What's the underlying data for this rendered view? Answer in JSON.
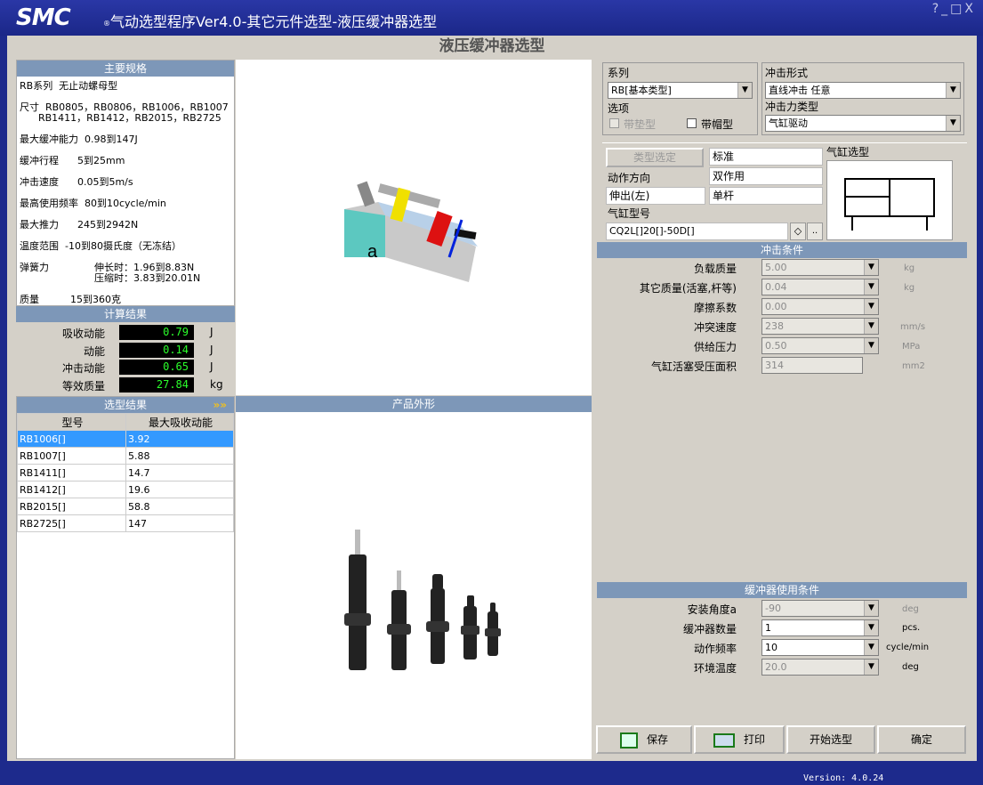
{
  "window": {
    "logo": "SMC",
    "logo_mark": "®",
    "title": "气动选型程序Ver4.0-其它元件选型-液压缓冲器选型",
    "controls": "?_□X"
  },
  "page_title": "液压缓冲器选型",
  "specs": {
    "header": "主要规格",
    "series": "RB系列  无止动螺母型",
    "sizes_1": "尺寸  RB0805，RB0806，RB1006，RB1007",
    "sizes_2": "      RB1411，RB1412，RB2015，RB2725",
    "energy": "最大缓冲能力  0.98到147J",
    "stroke": "缓冲行程      5到25mm",
    "speed": "冲击速度      0.05到5m/s",
    "freq": "最高使用频率  80到10cycle/min",
    "thrust": "最大推力      245到2942N",
    "temp": "温度范围  -10到80摄氏度（无冻结）",
    "spring_label": "弹簧力",
    "spring_1": "伸长时：1.96到8.83N",
    "spring_2": "压缩时：3.83到20.01N",
    "mass": "质量          15到360克"
  },
  "calc": {
    "header": "计算结果",
    "rows": [
      {
        "label": "吸收动能",
        "value": "0.79",
        "unit": "J"
      },
      {
        "label": "动能",
        "value": "0.14",
        "unit": "J"
      },
      {
        "label": "冲击动能",
        "value": "0.65",
        "unit": "J"
      },
      {
        "label": "等效质量",
        "value": "27.84",
        "unit": "kg"
      }
    ]
  },
  "results": {
    "header": "选型结果",
    "arrows": "»»",
    "col_model": "型号",
    "col_energy": "最大吸收动能",
    "rows": [
      {
        "model": "RB1006[]",
        "energy": "3.92"
      },
      {
        "model": "RB1007[]",
        "energy": "5.88"
      },
      {
        "model": "RB1411[]",
        "energy": "14.7"
      },
      {
        "model": "RB1412[]",
        "energy": "19.6"
      },
      {
        "model": "RB2015[]",
        "energy": "58.8"
      },
      {
        "model": "RB2725[]",
        "energy": "147"
      }
    ]
  },
  "diagram_label": "a",
  "product_header": "产品外形",
  "series_box": {
    "label": "系列",
    "value": "RB[基本类型]",
    "options_label": "选项",
    "opt_pad": "带垫型",
    "opt_cap": "带帽型"
  },
  "impact_box": {
    "label": "冲击形式",
    "value": "直线冲击   任意",
    "force_label": "冲击力类型",
    "force_value": "气缸驱动"
  },
  "cyl": {
    "type_btn": "类型选定",
    "type_val": "标准",
    "dir_label": "动作方向",
    "dir_val": "双作用",
    "extend": "伸出(左)",
    "rod": "单杆",
    "model_label": "气缸型号",
    "model_val": "CQ2L[]20[]-50D[]",
    "select_label": "气缸选型"
  },
  "impact_cond": {
    "header": "冲击条件",
    "rows": [
      {
        "label": "负载质量",
        "value": "5.00",
        "unit": "kg"
      },
      {
        "label": "其它质量(活塞,杆等)",
        "value": "0.04",
        "unit": "kg"
      },
      {
        "label": "摩擦系数",
        "value": "0.00",
        "unit": ""
      },
      {
        "label": "冲突速度",
        "value": "238",
        "unit": "mm/s"
      },
      {
        "label": "供给压力",
        "value": "0.50",
        "unit": "MPa"
      },
      {
        "label": "气缸活塞受压面积",
        "value": "314",
        "unit": "mm2"
      }
    ]
  },
  "usage_cond": {
    "header": "缓冲器使用条件",
    "rows": [
      {
        "label": "安装角度a",
        "value": "-90",
        "unit": "deg"
      },
      {
        "label": "缓冲器数量",
        "value": "1",
        "unit": "pcs."
      },
      {
        "label": "动作频率",
        "value": "10",
        "unit": "cycle/min"
      },
      {
        "label": "环境温度",
        "value": "20.0",
        "unit": "deg"
      }
    ]
  },
  "buttons": {
    "save": "保存",
    "print": "打印",
    "start": "开始选型",
    "ok": "确定"
  },
  "version": "Version: 4.0.24"
}
